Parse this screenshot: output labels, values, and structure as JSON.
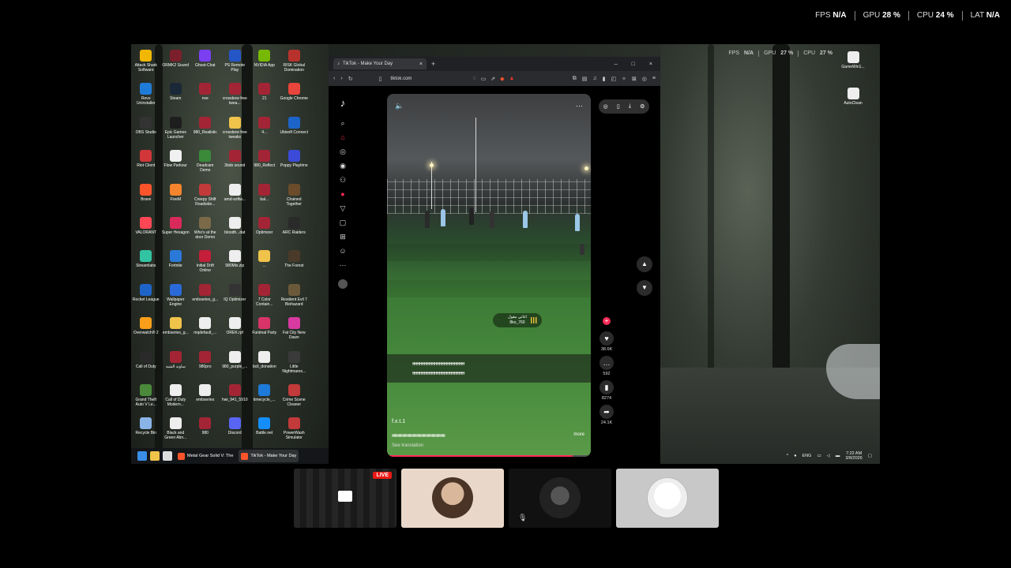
{
  "outer_perf": [
    {
      "label": "FPS",
      "value": "N/A"
    },
    {
      "label": "GPU",
      "value": "28 %"
    },
    {
      "label": "CPU",
      "value": "24 %"
    },
    {
      "label": "LAT",
      "value": "N/A"
    }
  ],
  "inner_perf": [
    {
      "label": "FPS",
      "value": "N/A"
    },
    {
      "label": "GPU",
      "value": "27 %"
    },
    {
      "label": "CPU",
      "value": "27 %"
    }
  ],
  "desktop_icons": [
    {
      "label": "Attack Shark Software",
      "color": "#f2b705"
    },
    {
      "label": "ORMK2 Sound",
      "color": "#7a1f2b"
    },
    {
      "label": "Ghost-Chat",
      "color": "#7b3ff2"
    },
    {
      "label": "PS Remote Play",
      "color": "#2456c8"
    },
    {
      "label": "NVIDIA App",
      "color": "#76b900"
    },
    {
      "label": "RISK Global Domination",
      "color": "#b8322d"
    },
    {
      "label": "Revo Uninstaller",
      "color": "#1f7bd8"
    },
    {
      "label": "Steam",
      "color": "#1b2838"
    },
    {
      "label": "nve",
      "color": "#a32535"
    },
    {
      "label": "crossbow free twea...",
      "color": "#a32535"
    },
    {
      "label": "21",
      "color": "#a32535"
    },
    {
      "label": "Google Chrome",
      "color": "#e8453c"
    },
    {
      "label": "OBS Studio",
      "color": "#333333"
    },
    {
      "label": "Epic Games Launcher",
      "color": "#1e1e1e"
    },
    {
      "label": "980_Realistic",
      "color": "#a32535"
    },
    {
      "label": "crossbow free tweaks",
      "color": "#f0c34a"
    },
    {
      "label": "4...",
      "color": "#a32535"
    },
    {
      "label": "Ubisoft Connect",
      "color": "#1c64c9"
    },
    {
      "label": "Riot Client",
      "color": "#d13639"
    },
    {
      "label": "Flow Parkour",
      "color": "#f0f0f0"
    },
    {
      "label": "Deadcam Demo",
      "color": "#3a8a3a"
    },
    {
      "label": "3bdo sound",
      "color": "#a32535"
    },
    {
      "label": "980_Reflect",
      "color": "#a32535"
    },
    {
      "label": "Poppy Playtime",
      "color": "#3b4bd8"
    },
    {
      "label": "Brave",
      "color": "#fb542b"
    },
    {
      "label": "FiveM",
      "color": "#f4852d"
    },
    {
      "label": "Creepy Shift Roadside...",
      "color": "#c23a3a"
    },
    {
      "label": "amd-softw...",
      "color": "#eeeeee"
    },
    {
      "label": "bal...",
      "color": "#a32535"
    },
    {
      "label": "Chained Together",
      "color": "#6b4b2a"
    },
    {
      "label": "VALORANT",
      "color": "#ff4655"
    },
    {
      "label": "Super Hexagon",
      "color": "#d82a5a"
    },
    {
      "label": "Who's at the door Demo",
      "color": "#7a6a4a"
    },
    {
      "label": "bloodh...dat",
      "color": "#eeeeee"
    },
    {
      "label": "Optimizer",
      "color": "#a32535"
    },
    {
      "label": "ARC Raiders",
      "color": "#2a2a2a"
    },
    {
      "label": "Streamlabs",
      "color": "#31c3a2"
    },
    {
      "label": "Fortnite",
      "color": "#2a79d8"
    },
    {
      "label": "Initial Drift Online",
      "color": "#c41e3a"
    },
    {
      "label": "980Mix.zip",
      "color": "#eeeeee"
    },
    {
      "label": "...",
      "color": "#f0c34a"
    },
    {
      "label": "The Forest",
      "color": "#4a3a2a"
    },
    {
      "label": "Rocket League",
      "color": "#1e64c8"
    },
    {
      "label": "Wallpaper Engine",
      "color": "#2a6ad8"
    },
    {
      "label": "embseries_g...",
      "color": "#a32535"
    },
    {
      "label": "IQ Optimizer",
      "color": "#333333"
    },
    {
      "label": "7 Color Contain...",
      "color": "#a32535"
    },
    {
      "label": "Resident Evil 7 Biohazard",
      "color": "#6b5a3a"
    },
    {
      "label": "Overwatch® 2",
      "color": "#f99e1a"
    },
    {
      "label": "embseries_g...",
      "color": "#f0c34a"
    },
    {
      "label": "mqdefault_...",
      "color": "#eeeeee"
    },
    {
      "label": "OREK.rpf",
      "color": "#eeeeee"
    },
    {
      "label": "Funimal Party",
      "color": "#d8346a"
    },
    {
      "label": "Fat City New Dawn",
      "color": "#d83aa0"
    },
    {
      "label": "Call of Duty",
      "color": "#2a2a2a"
    },
    {
      "label": "ساوند الشبه",
      "color": "#a32535"
    },
    {
      "label": "980pro",
      "color": "#a32535"
    },
    {
      "label": "980_purple_...",
      "color": "#eeeeee"
    },
    {
      "label": "bcit_donation",
      "color": "#eeeeee"
    },
    {
      "label": "Little Nightmares...",
      "color": "#3a3a3a"
    },
    {
      "label": "Grand Theft Auto V Le...",
      "color": "#4a8a3a"
    },
    {
      "label": "Call of Duty Modern...",
      "color": "#eeeeee"
    },
    {
      "label": "embseries",
      "color": "#eeeeee"
    },
    {
      "label": "hwi_941_5910",
      "color": "#a32535"
    },
    {
      "label": "timecycle_...",
      "color": "#1e7ad8"
    },
    {
      "label": "Crime Scene Cleaner",
      "color": "#c23a3a"
    },
    {
      "label": "Recycle Bin",
      "color": "#8ab4e8"
    },
    {
      "label": "Black and Green Abn...",
      "color": "#eeeeee"
    },
    {
      "label": "980",
      "color": "#a32535"
    },
    {
      "label": "Discord",
      "color": "#5865f2"
    },
    {
      "label": "Battle.net",
      "color": "#148eff"
    },
    {
      "label": "PowerWash Simulator",
      "color": "#c23a3a"
    }
  ],
  "right_icons": [
    {
      "label": "GameWin1...",
      "color": "#eeeeee"
    },
    {
      "label": "AutoClean",
      "color": "#eeeeee"
    }
  ],
  "taskbar": {
    "apps": [
      {
        "label": "Metal Gear Solid V: The",
        "color": "#fb542b"
      },
      {
        "label": "TikTok - Make Your Day",
        "color": "#fb542b"
      }
    ],
    "lang": "ENG",
    "time": "7:22 AM",
    "date": "3/8/2026"
  },
  "browser": {
    "tab_title": "TikTok - Make Your Day",
    "url": "tiktok.com"
  },
  "video": {
    "song_title": "اغاني مقول",
    "song_user": "8ko_760",
    "caption_line1": "ɫɫɫɫɫɫɫɫɫɫɫɫɫɫɫɫɫɫɫɫɫɫɫɫɫɫɫɫɫɫɫɫɫɫɫɫɫɫɫɫɫɫɫɫɫ",
    "caption_line2": "ɫɫɫɫɫɫɫɫɫɫɫɫɫɫɫɫɫɫɫɫɫɫɫɫɫɫɫɫɫɫɫɫɫɫɫɫɫɫɫɫɫɫɫɫɫ",
    "author": "f.x.t.1",
    "description": "ɫɫɫɫɫɫɫɫɫɫɫɫɫɫɫɫɫɫɫɫɫɫɫɫɫɫɫɫɫɫɫɫɫɫɫɫɫɫɫɫɫɫɫɫɫɫɫɫɫɫɫɫɫɫɫɫ",
    "more": "more",
    "see_translation": "See translation",
    "progress": 0.91
  },
  "actions": {
    "likes": "38.6K",
    "comments": "592",
    "saves": "8274",
    "shares": "24.1K"
  },
  "tiles": {
    "live": "LIVE"
  }
}
